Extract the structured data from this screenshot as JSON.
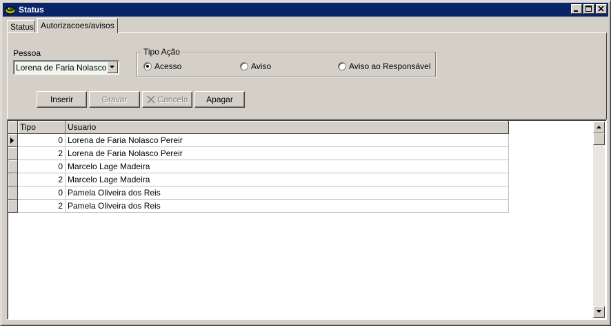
{
  "window": {
    "title": "Status",
    "title_bar_color": "#0a246a",
    "controls": [
      "minimize-icon",
      "maximize-icon",
      "close-icon"
    ]
  },
  "tabs": [
    {
      "label": "Status",
      "active": false
    },
    {
      "label": "Autorizacoes/avisos",
      "active": true
    }
  ],
  "form": {
    "pessoa_label": "Pessoa",
    "pessoa_value": "Lorena de Faria Nolasco Pereir",
    "tipo_acao_label": "Tipo Ação",
    "radios": [
      {
        "label": "Acesso",
        "checked": true
      },
      {
        "label": "Aviso",
        "checked": false
      },
      {
        "label": "Aviso ao Responsável",
        "checked": false
      }
    ]
  },
  "buttons": {
    "inserir": "Inserir",
    "gravar": "Gravar",
    "cancela": "Cancela",
    "apagar": "Apagar"
  },
  "grid": {
    "columns": [
      "Tipo",
      "Usuario"
    ],
    "rows": [
      {
        "tipo": "0",
        "usuario": "Lorena de Faria Nolasco Pereir",
        "current": true
      },
      {
        "tipo": "2",
        "usuario": "Lorena de Faria Nolasco Pereir",
        "current": false
      },
      {
        "tipo": "0",
        "usuario": "Marcelo Lage Madeira",
        "current": false
      },
      {
        "tipo": "2",
        "usuario": "Marcelo Lage Madeira",
        "current": false
      },
      {
        "tipo": "0",
        "usuario": "Pamela Oliveira dos Reis",
        "current": false
      },
      {
        "tipo": "2",
        "usuario": "Pamela Oliveira dos Reis",
        "current": false
      }
    ]
  }
}
